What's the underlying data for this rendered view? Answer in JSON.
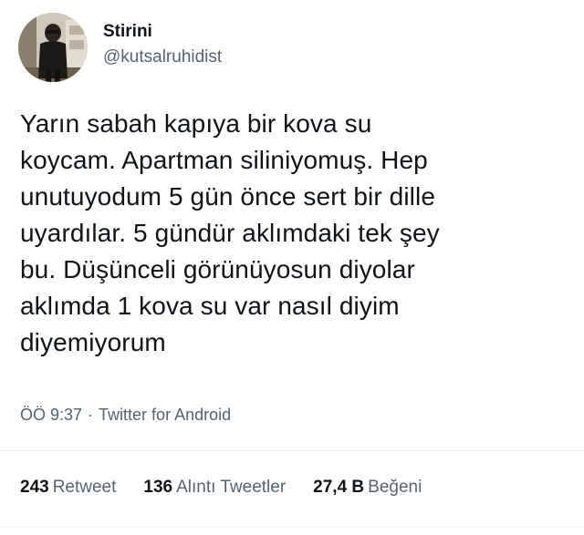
{
  "author": {
    "display_name": "Stirini",
    "handle": "@kutsalruhidist",
    "avatar": "profile-photo"
  },
  "tweet": {
    "text": "Yarın sabah kapıya bir kova su\nkoycam. Apartman siliniyomuş. Hep\nunutuyodum 5 gün önce sert bir dille\nuyardılar. 5 gündür aklımdaki tek şey\nbu. Düşünceli görünüyosun diyolar\naklımda 1 kova su var nasıl diyim\ndiyemiyorum",
    "time": "ÖÖ 9:37",
    "separator": "·",
    "source": "Twitter for Android"
  },
  "stats": {
    "retweets": {
      "count": "243",
      "label": "Retweet"
    },
    "quotes": {
      "count": "136",
      "label": "Alıntı Tweetler"
    },
    "likes": {
      "count": "27,4 B",
      "label": "Beğeni"
    }
  },
  "colors": {
    "text_primary": "#0f1419",
    "text_secondary": "#536471",
    "divider": "#eff3f4"
  }
}
